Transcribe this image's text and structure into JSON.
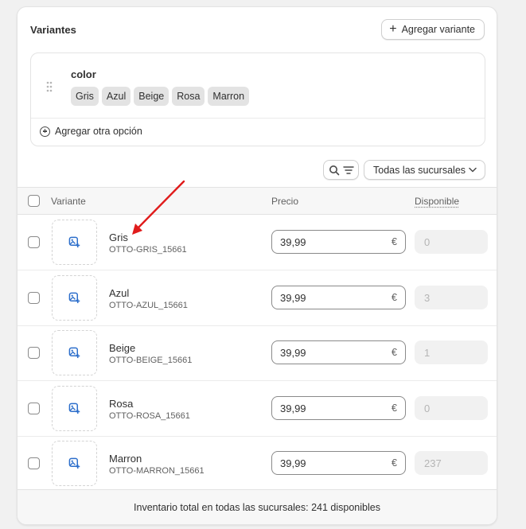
{
  "card": {
    "title": "Variantes",
    "add_variant_label": "Agregar variante"
  },
  "options": {
    "name": "color",
    "values": [
      "Gris",
      "Azul",
      "Beige",
      "Rosa",
      "Marron"
    ],
    "add_option_label": "Agregar otra opción"
  },
  "toolbar": {
    "location_select": "Todas las sucursales"
  },
  "table": {
    "headers": {
      "variant": "Variante",
      "price": "Precio",
      "available": "Disponible"
    },
    "rows": [
      {
        "name": "Gris",
        "sku": "OTTO-GRIS_15661",
        "price": "39,99",
        "currency": "€",
        "available": "0"
      },
      {
        "name": "Azul",
        "sku": "OTTO-AZUL_15661",
        "price": "39,99",
        "currency": "€",
        "available": "3"
      },
      {
        "name": "Beige",
        "sku": "OTTO-BEIGE_15661",
        "price": "39,99",
        "currency": "€",
        "available": "1"
      },
      {
        "name": "Rosa",
        "sku": "OTTO-ROSA_15661",
        "price": "39,99",
        "currency": "€",
        "available": "0"
      },
      {
        "name": "Marron",
        "sku": "OTTO-MARRON_15661",
        "price": "39,99",
        "currency": "€",
        "available": "237"
      }
    ]
  },
  "footer": {
    "inventory_total": "Inventario total en todas las sucursales: 241 disponibles"
  },
  "colors": {
    "accent": "#2c6ecb",
    "annotation_arrow": "#e01b1b"
  }
}
